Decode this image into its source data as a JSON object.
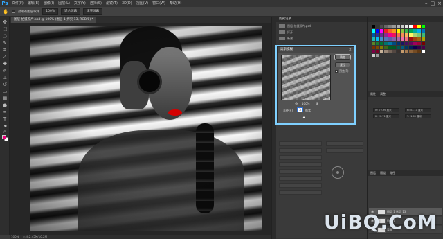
{
  "app": {
    "logo": "Ps"
  },
  "menu": [
    "文件(F)",
    "编辑(E)",
    "图像(I)",
    "图层(L)",
    "文字(Y)",
    "选择(S)",
    "滤镜(T)",
    "3D(D)",
    "视图(V)",
    "窗口(W)",
    "帮助(H)"
  ],
  "window_controls": {
    "minimize": "–",
    "maximize": "□",
    "close": "×"
  },
  "options": {
    "sample_all_layers": "对所有图层取样",
    "zoom_value": "100%",
    "fit_screen": "适合屏幕",
    "fill_screen": "填充屏幕"
  },
  "document": {
    "tab_label": "图层-拍摄照片.psd @ 100% (图层 1 拷贝 13, RGB/8) *"
  },
  "status": {
    "zoom": "100%",
    "doc_size": "文档:2.45M/10.2M"
  },
  "history": {
    "header": "历史记录",
    "items": [
      "图层-拍摄照片.psd",
      "打开",
      "新建"
    ]
  },
  "dialog": {
    "title": "高斯模糊",
    "ok_label": "确定",
    "reset_label": "复位",
    "preview_label": "预览(P)",
    "zoom_label": "100%",
    "zoom_out_icon": "zoom-out-icon",
    "zoom_in_icon": "zoom-in-icon",
    "radius_label": "半径(R):",
    "radius_value": "3",
    "radius_unit": "像素"
  },
  "right_panel": {
    "swatch_colors": [
      "#000000",
      "#333333",
      "#4d4d4d",
      "#666666",
      "#808080",
      "#999999",
      "#b3b3b3",
      "#cccccc",
      "#e6e6e6",
      "#ffffff",
      "#ff0000",
      "#ffff00",
      "#00ff00",
      "#00ffff",
      "#0000ff",
      "#ff00ff",
      "#ed1c24",
      "#f26522",
      "#f7941d",
      "#fff200",
      "#8dc63f",
      "#39b54a",
      "#00a651",
      "#00a99d",
      "#00aeef",
      "#0072bc",
      "#0054a6",
      "#2e3192",
      "#662d91",
      "#92278f",
      "#ec008c",
      "#ed145b",
      "#f26c4f",
      "#f68e56",
      "#fbaf5d",
      "#fff568",
      "#acd373",
      "#7cc576",
      "#3cb878",
      "#1cbbb4",
      "#00bff3",
      "#448ccb",
      "#5574b9",
      "#605ca8",
      "#8560a8",
      "#a864a8",
      "#f06eaa",
      "#f26d7d",
      "#9e0b0f",
      "#a0410d",
      "#a36209",
      "#aba000",
      "#598527",
      "#1a7b30",
      "#007236",
      "#00746b",
      "#0076a3",
      "#004b80",
      "#003471",
      "#1b1464",
      "#440e62",
      "#630460",
      "#9e005d",
      "#9e0039",
      "#790000",
      "#7b2e00",
      "#7d4900",
      "#827b00",
      "#406618",
      "#005e20",
      "#005826",
      "#005952",
      "#005b7f",
      "#003663",
      "#002157",
      "#0d004c",
      "#32004b",
      "#4b0049",
      "#7b0046",
      "#7a0026",
      "#c7b299",
      "#998675",
      "#736357",
      "#534741",
      "#37302d",
      "#c69c6d",
      "#a67c52",
      "#8c6239",
      "#754c24",
      "#603913",
      "#ffffff",
      "#cccccc",
      "#999999"
    ],
    "props_tab_1": "属性",
    "props_tab_2": "调整",
    "w_field": "W: 72.96 厘米",
    "h_field": "H: 53.11 厘米",
    "x_field": "X: 20.71 厘米",
    "y_field": "Y: -1.09 厘米",
    "layers_tabs": [
      "图层",
      "通道",
      "路径"
    ],
    "layers": [
      {
        "name": "图层 1 拷贝 13",
        "active": true
      },
      {
        "name": "图层 1",
        "active": false
      },
      {
        "name": "背景",
        "active": false
      }
    ]
  },
  "watermark": "UiBQ.CoM"
}
